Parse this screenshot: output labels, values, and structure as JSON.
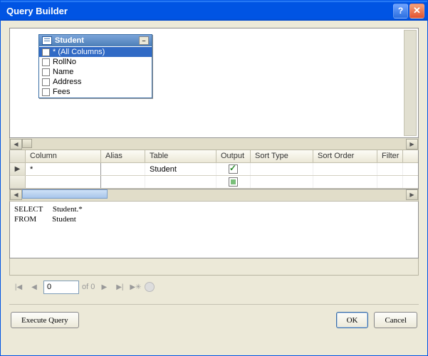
{
  "window": {
    "title": "Query Builder"
  },
  "table_widget": {
    "title": "Student",
    "items": [
      {
        "label": "* (All Columns)",
        "checked": true,
        "selected": true
      },
      {
        "label": "RollNo",
        "checked": false,
        "selected": false
      },
      {
        "label": "Name",
        "checked": false,
        "selected": false
      },
      {
        "label": "Address",
        "checked": false,
        "selected": false
      },
      {
        "label": "Fees",
        "checked": false,
        "selected": false
      }
    ]
  },
  "grid": {
    "headers": {
      "column": "Column",
      "alias": "Alias",
      "table": "Table",
      "output": "Output",
      "sort_type": "Sort Type",
      "sort_order": "Sort Order",
      "filter": "Filter"
    },
    "rows": [
      {
        "column": "*",
        "alias": "",
        "table": "Student",
        "output": "checked",
        "sort_type": "",
        "sort_order": "",
        "filter": ""
      },
      {
        "column": "",
        "alias": "",
        "table": "",
        "output": "new",
        "sort_type": "",
        "sort_order": "",
        "filter": ""
      }
    ]
  },
  "sql": "SELECT     Student.*\nFROM        Student",
  "nav": {
    "pos": "0",
    "of_label": "of 0"
  },
  "buttons": {
    "execute": "Execute Query",
    "ok": "OK",
    "cancel": "Cancel"
  }
}
